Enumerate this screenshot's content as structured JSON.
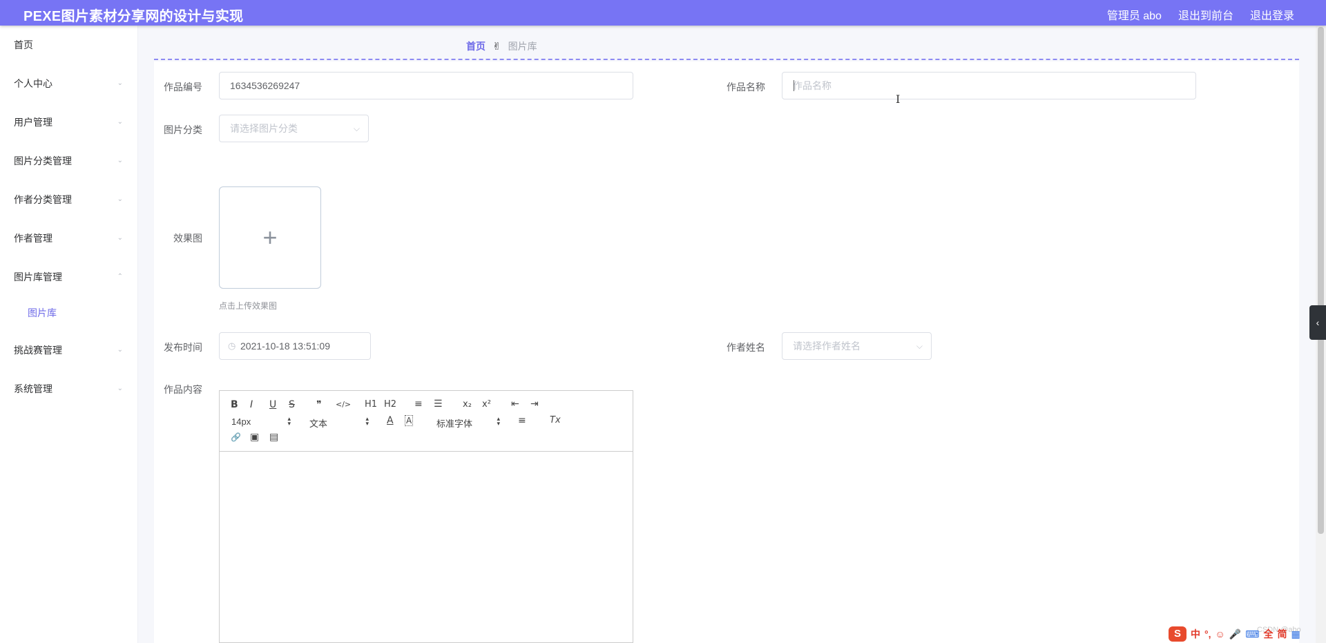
{
  "header": {
    "title": "PEXE图片素材分享网的设计与实现",
    "admin_label": "管理员 abo",
    "back_front_label": "退出到前台",
    "logout_label": "退出登录",
    "bg_color": "#7774f4"
  },
  "sidebar": {
    "items": [
      {
        "label": "首页"
      },
      {
        "label": "个人中心"
      },
      {
        "label": "用户管理"
      },
      {
        "label": "图片分类管理"
      },
      {
        "label": "作者分类管理"
      },
      {
        "label": "作者管理"
      },
      {
        "label": "图片库管理"
      },
      {
        "label": "挑战赛管理"
      },
      {
        "label": "系统管理"
      }
    ],
    "sub_item": {
      "label": "图片库"
    },
    "chevron_down": "⌄",
    "chevron_up": "⌃"
  },
  "breadcrumb": {
    "home": "首页",
    "separator_icon": "hand-icon",
    "separator_glyph": "✌",
    "current": "图片库"
  },
  "form": {
    "work_id_label": "作品编号",
    "work_id_value": "1634536269247",
    "work_name_label": "作品名称",
    "work_name_placeholder": "作品名称",
    "category_label": "图片分类",
    "category_placeholder": "请选择图片分类",
    "effect_label": "效果图",
    "upload_plus": "+",
    "upload_tip": "点击上传效果图",
    "publish_time_label": "发布时间",
    "publish_time_value": "2021-10-18 13:51:09",
    "author_label": "作者姓名",
    "author_placeholder": "请选择作者姓名",
    "content_label": "作品内容"
  },
  "editor": {
    "toolbar_row1": [
      {
        "name": "bold",
        "glyph": "B"
      },
      {
        "name": "italic",
        "glyph": "I"
      },
      {
        "name": "underline",
        "glyph": "U"
      },
      {
        "name": "strike",
        "glyph": "S"
      },
      {
        "name": "blockquote",
        "glyph": "❞"
      },
      {
        "name": "code-block",
        "glyph": "</>"
      },
      {
        "name": "header-1",
        "glyph": "H1"
      },
      {
        "name": "header-2",
        "glyph": "H2"
      },
      {
        "name": "ordered-list",
        "glyph": "≡"
      },
      {
        "name": "bullet-list",
        "glyph": "☰"
      },
      {
        "name": "subscript",
        "glyph": "x₂"
      },
      {
        "name": "superscript",
        "glyph": "x²"
      },
      {
        "name": "outdent",
        "glyph": "⇤"
      },
      {
        "name": "indent",
        "glyph": "⇥"
      }
    ],
    "size_value": "14px",
    "header_value": "文本",
    "font_value": "标准字体",
    "color_glyph": "A",
    "background_glyph": "A",
    "align_glyph": "≡",
    "clean_glyph": "Tx",
    "link_glyph": "🔗",
    "image_glyph": "▣",
    "video_glyph": "▤"
  },
  "ime": {
    "logo": "S",
    "items": [
      "中",
      "°,",
      "☺",
      "🎤",
      "⌨",
      "全",
      "简",
      "▦"
    ]
  },
  "watermark": "CSDN @abo"
}
